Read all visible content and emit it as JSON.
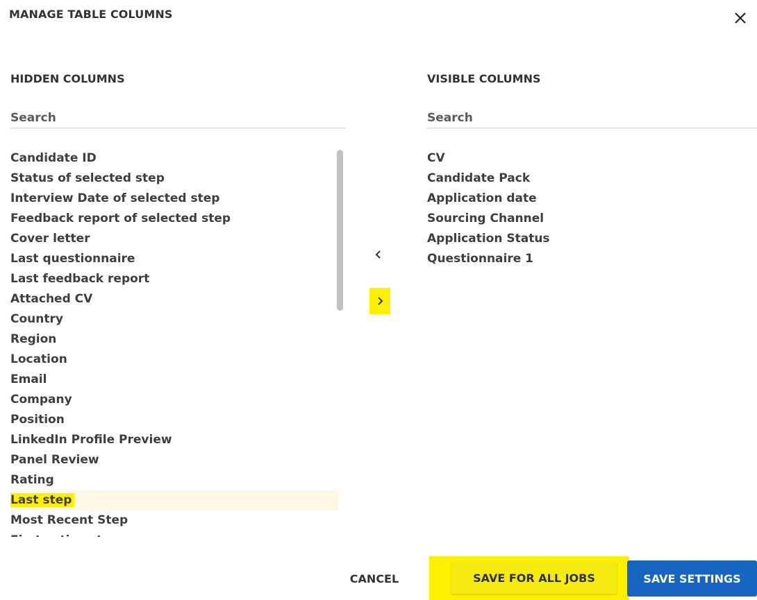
{
  "dialog": {
    "title": "MANAGE TABLE COLUMNS",
    "close_icon": "close-icon"
  },
  "hidden": {
    "header": "HIDDEN COLUMNS",
    "search_placeholder": "Search",
    "items": [
      "Candidate ID",
      "Status of selected step",
      "Interview Date of selected step",
      "Feedback report of selected step",
      "Cover letter",
      "Last questionnaire",
      "Last feedback report",
      "Attached CV",
      "Country",
      "Region",
      "Location",
      "Email",
      "Company",
      "Position",
      "LinkedIn Profile Preview",
      "Panel Review",
      "Rating",
      "Last step",
      "Most Recent Step",
      "First active step"
    ],
    "selected_index": 17
  },
  "visible": {
    "header": "VISIBLE COLUMNS",
    "search_placeholder": "Search",
    "items": [
      "CV",
      "Candidate Pack",
      "Application date",
      "Sourcing Channel",
      "Application Status",
      "Questionnaire 1"
    ]
  },
  "controls": {
    "move_left_icon": "chevron-left-icon",
    "move_right_icon": "chevron-right-icon"
  },
  "footer": {
    "cancel_label": "CANCEL",
    "save_all_label": "SAVE FOR ALL JOBS",
    "save_label": "SAVE SETTINGS"
  },
  "colors": {
    "highlight": "#fff000",
    "primary": "#1565c0"
  }
}
